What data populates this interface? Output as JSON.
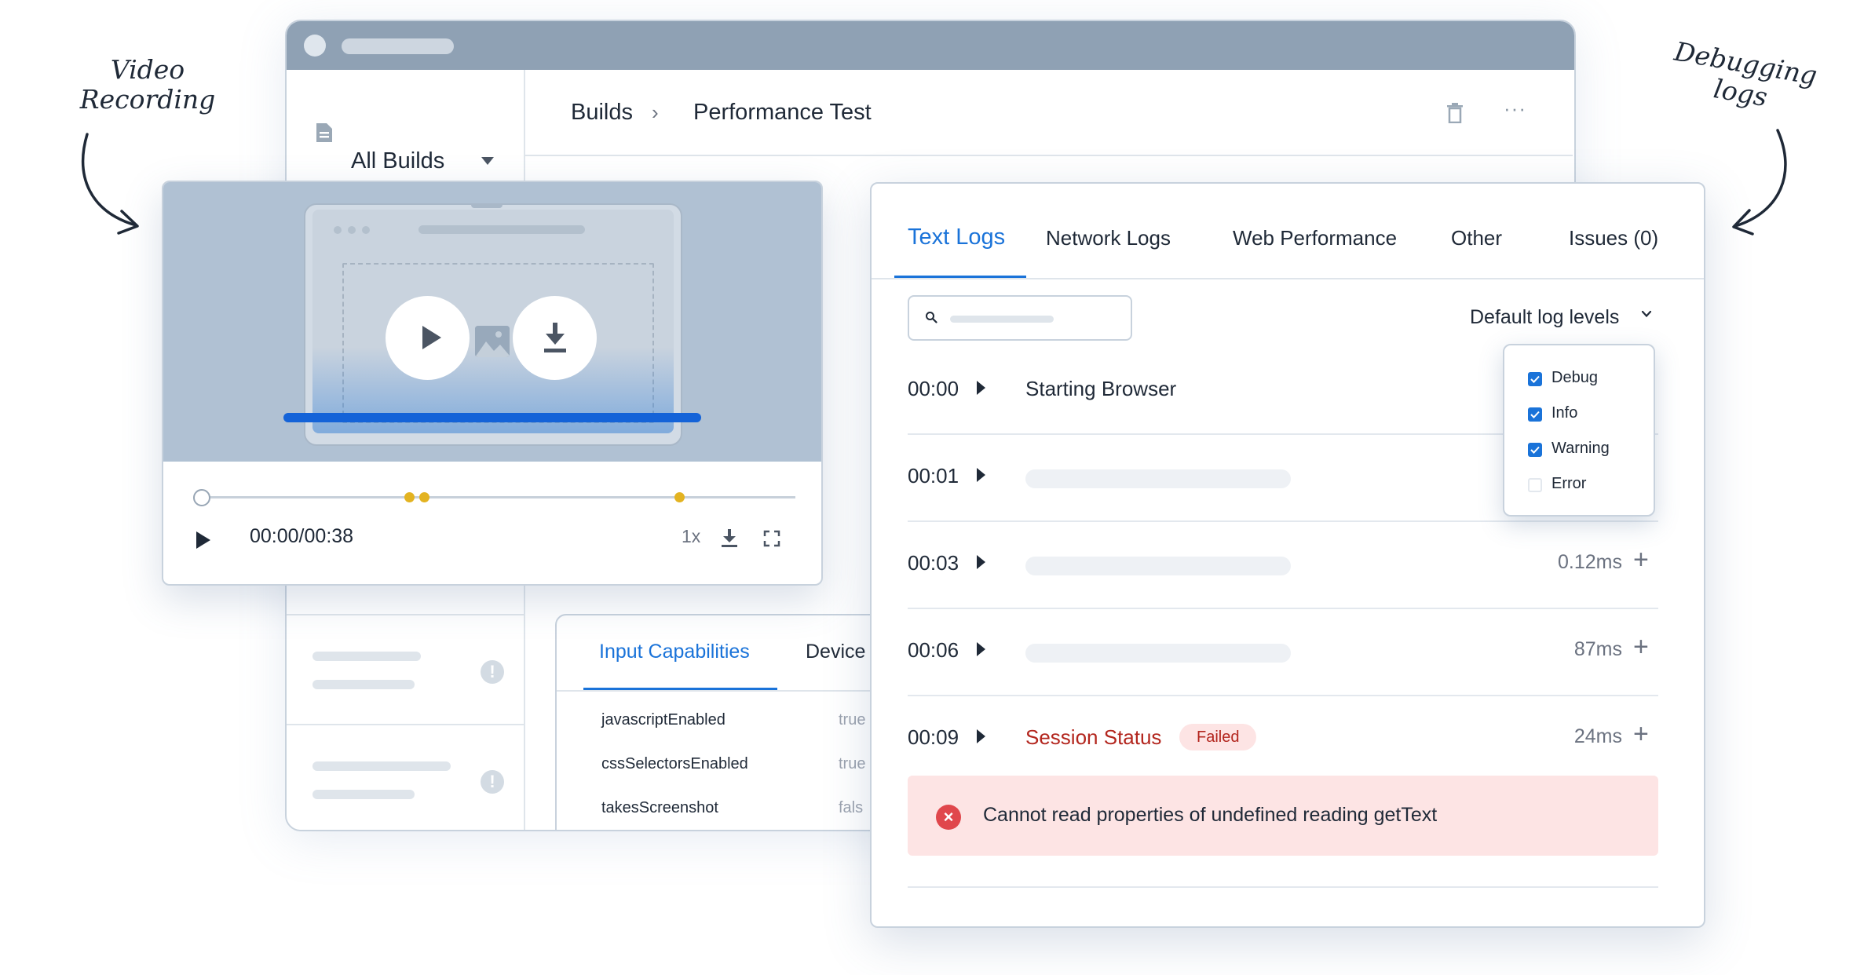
{
  "annotations": {
    "left": "Video\nRecording",
    "right": "Debugging\nlogs"
  },
  "builds": {
    "dropdown_label": "All Builds",
    "breadcrumb": [
      "Builds",
      "Performance Test"
    ],
    "more_label": "···"
  },
  "capabilities": {
    "tabs": [
      "Input Capabilities",
      "Device"
    ],
    "rows": [
      {
        "key": "javascriptEnabled",
        "value": "true"
      },
      {
        "key": "cssSelectorsEnabled",
        "value": "true"
      },
      {
        "key": "takesScreenshot",
        "value": "fals"
      }
    ]
  },
  "video": {
    "time": "00:00/00:38",
    "speed": "1x",
    "progress": 0
  },
  "logs": {
    "tabs": [
      "Text Logs",
      "Network Logs",
      "Web Performance",
      "Other",
      "Issues (0)"
    ],
    "active_tab": "Text Logs",
    "level_filter": "Default log levels",
    "levels": [
      {
        "label": "Debug",
        "checked": true
      },
      {
        "label": "Info",
        "checked": true
      },
      {
        "label": "Warning",
        "checked": true
      },
      {
        "label": "Error",
        "checked": false
      }
    ],
    "rows": [
      {
        "time": "00:00",
        "text": "Starting Browser",
        "duration": ""
      },
      {
        "time": "00:01",
        "text": "",
        "duration": ""
      },
      {
        "time": "00:03",
        "text": "",
        "duration": "0.12ms"
      },
      {
        "time": "00:06",
        "text": "",
        "duration": "87ms"
      },
      {
        "time": "00:09",
        "text": "Session Status",
        "badge": "Failed",
        "duration": "24ms"
      }
    ],
    "error_message": "Cannot read properties of undefined reading getText"
  },
  "colors": {
    "accent": "#1a73d9",
    "error": "#b3261e",
    "error_bg": "#fde4e4",
    "marker": "#e3b321"
  }
}
